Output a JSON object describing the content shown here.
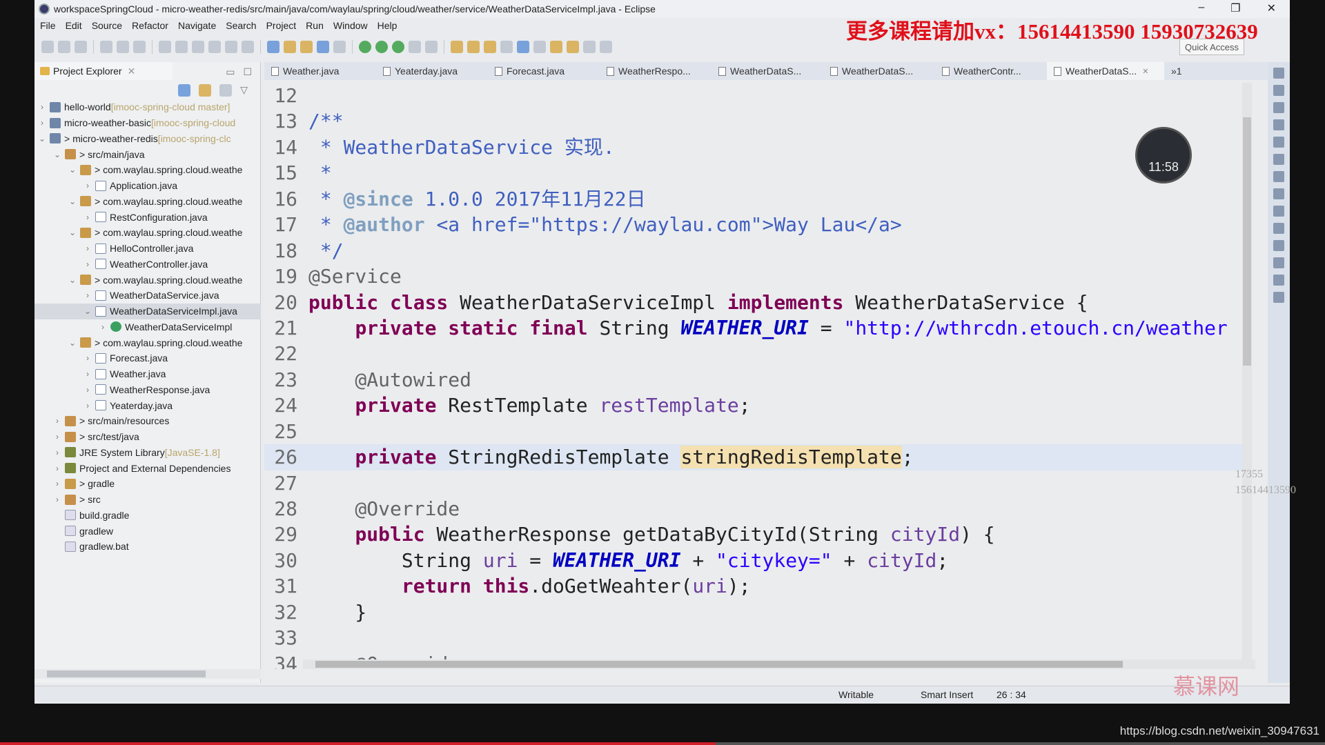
{
  "window": {
    "title": "workspaceSpringCloud - micro-weather-redis/src/main/java/com/waylau/spring/cloud/weather/service/WeatherDataServiceImpl.java - Eclipse",
    "controls": [
      "–",
      "❐",
      "✕"
    ]
  },
  "overlay": {
    "promo": "更多课程请加vx：15614413590  15930732639",
    "clock": "11:58",
    "side_watermark": [
      "17355",
      "15614413590"
    ],
    "url": "https://blog.csdn.net/weixin_30947631",
    "logo": "慕课网",
    "progress": 0.54
  },
  "menu": [
    "File",
    "Edit",
    "Source",
    "Refactor",
    "Navigate",
    "Search",
    "Project",
    "Run",
    "Window",
    "Help"
  ],
  "toolbar": {
    "quick_access": "Quick Access"
  },
  "explorer": {
    "title": "Project Explorer",
    "items": [
      {
        "d": 0,
        "tw": ">",
        "ic": "proj",
        "label": "hello-world",
        "dec": " [imooc-spring-cloud master]"
      },
      {
        "d": 0,
        "tw": ">",
        "ic": "proj",
        "label": "micro-weather-basic",
        "dec": " [imooc-spring-cloud"
      },
      {
        "d": 0,
        "tw": "v",
        "ic": "proj",
        "label": "> micro-weather-redis",
        "dec": " [imooc-spring-clc"
      },
      {
        "d": 1,
        "tw": "v",
        "ic": "src",
        "label": "> src/main/java"
      },
      {
        "d": 2,
        "tw": "v",
        "ic": "pkg",
        "label": "> com.waylau.spring.cloud.weathe"
      },
      {
        "d": 3,
        "tw": ">",
        "ic": "java",
        "label": "Application.java"
      },
      {
        "d": 2,
        "tw": "v",
        "ic": "pkg",
        "label": "> com.waylau.spring.cloud.weathe"
      },
      {
        "d": 3,
        "tw": ">",
        "ic": "java",
        "label": "RestConfiguration.java"
      },
      {
        "d": 2,
        "tw": "v",
        "ic": "pkg",
        "label": "> com.waylau.spring.cloud.weathe"
      },
      {
        "d": 3,
        "tw": ">",
        "ic": "java",
        "label": "HelloController.java"
      },
      {
        "d": 3,
        "tw": ">",
        "ic": "java",
        "label": "WeatherController.java"
      },
      {
        "d": 2,
        "tw": "v",
        "ic": "pkg",
        "label": "> com.waylau.spring.cloud.weathe"
      },
      {
        "d": 3,
        "tw": ">",
        "ic": "java",
        "label": "WeatherDataService.java"
      },
      {
        "d": 3,
        "tw": "v",
        "ic": "java",
        "label": "WeatherDataServiceImpl.java",
        "sel": true
      },
      {
        "d": 4,
        "tw": ">",
        "ic": "cls",
        "label": "WeatherDataServiceImpl"
      },
      {
        "d": 2,
        "tw": "v",
        "ic": "pkg",
        "label": "> com.waylau.spring.cloud.weathe"
      },
      {
        "d": 3,
        "tw": ">",
        "ic": "java",
        "label": "Forecast.java"
      },
      {
        "d": 3,
        "tw": ">",
        "ic": "java",
        "label": "Weather.java"
      },
      {
        "d": 3,
        "tw": ">",
        "ic": "java",
        "label": "WeatherResponse.java"
      },
      {
        "d": 3,
        "tw": ">",
        "ic": "java",
        "label": "Yeaterday.java"
      },
      {
        "d": 1,
        "tw": ">",
        "ic": "src",
        "label": "> src/main/resources"
      },
      {
        "d": 1,
        "tw": ">",
        "ic": "src",
        "label": "> src/test/java"
      },
      {
        "d": 1,
        "tw": ">",
        "ic": "lib",
        "label": "JRE System Library",
        "dec": " [JavaSE-1.8]"
      },
      {
        "d": 1,
        "tw": ">",
        "ic": "lib",
        "label": "Project and External Dependencies"
      },
      {
        "d": 1,
        "tw": ">",
        "ic": "pkg",
        "label": "> gradle"
      },
      {
        "d": 1,
        "tw": ">",
        "ic": "src",
        "label": "> src"
      },
      {
        "d": 1,
        "tw": "",
        "ic": "file",
        "label": "build.gradle"
      },
      {
        "d": 1,
        "tw": "",
        "ic": "file",
        "label": "gradlew"
      },
      {
        "d": 1,
        "tw": "",
        "ic": "file",
        "label": "gradlew.bat"
      }
    ]
  },
  "editor": {
    "tabs": [
      "Weather.java",
      "Yeaterday.java",
      "Forecast.java",
      "WeatherRespo...",
      "WeatherDataS...",
      "WeatherDataS...",
      "WeatherContr...",
      "WeatherDataS..."
    ],
    "active_tab": 7,
    "overflow": "»1",
    "lines": [
      {
        "n": "12",
        "t": []
      },
      {
        "n": "13",
        "t": [
          [
            "doc",
            "/**"
          ]
        ]
      },
      {
        "n": "14",
        "t": [
          [
            "doc",
            " * WeatherDataService 实现."
          ]
        ]
      },
      {
        "n": "15",
        "t": [
          [
            "doc",
            " *"
          ]
        ]
      },
      {
        "n": "16",
        "t": [
          [
            "doc",
            " * "
          ],
          [
            "tag",
            "@since"
          ],
          [
            "doc",
            " 1.0.0 2017年11月22日"
          ]
        ]
      },
      {
        "n": "17",
        "t": [
          [
            "doc",
            " * "
          ],
          [
            "tag",
            "@author"
          ],
          [
            "doc",
            " <a href=\"https://waylau.com\">Way Lau</a>"
          ]
        ]
      },
      {
        "n": "18",
        "t": [
          [
            "doc",
            " */"
          ]
        ]
      },
      {
        "n": "19",
        "t": [
          [
            "ann",
            "@Service"
          ]
        ]
      },
      {
        "n": "20",
        "t": [
          [
            "kw",
            "public class "
          ],
          [
            "pl",
            "WeatherDataServiceImpl "
          ],
          [
            "kw",
            "implements "
          ],
          [
            "pl",
            "WeatherDataService {"
          ]
        ]
      },
      {
        "n": "21",
        "t": [
          [
            "pl",
            "    "
          ],
          [
            "kw",
            "private static final "
          ],
          [
            "pl",
            "String "
          ],
          [
            "fld",
            "WEATHER_URI"
          ],
          [
            "pl",
            " = "
          ],
          [
            "str",
            "\"http://wthrcdn.etouch.cn/weather"
          ]
        ]
      },
      {
        "n": "22",
        "t": []
      },
      {
        "n": "23",
        "t": [
          [
            "ann",
            "    @Autowired"
          ]
        ]
      },
      {
        "n": "24",
        "t": [
          [
            "pl",
            "    "
          ],
          [
            "kw",
            "private "
          ],
          [
            "pl",
            "RestTemplate "
          ],
          [
            "fld2",
            "restTemplate"
          ],
          [
            "pl",
            ";"
          ]
        ]
      },
      {
        "n": "25",
        "t": []
      },
      {
        "n": "26",
        "t": [
          [
            "pl",
            "    "
          ],
          [
            "kw",
            "private "
          ],
          [
            "pl",
            "StringRedisTemplate "
          ],
          [
            "occ",
            "stringRedisTemplate"
          ],
          [
            "pl",
            ";"
          ]
        ],
        "hl": true
      },
      {
        "n": "27",
        "t": []
      },
      {
        "n": "28",
        "t": [
          [
            "ann",
            "    @Override"
          ]
        ]
      },
      {
        "n": "29",
        "t": [
          [
            "pl",
            "    "
          ],
          [
            "kw",
            "public "
          ],
          [
            "pl",
            "WeatherResponse getDataByCityId(String "
          ],
          [
            "var",
            "cityId"
          ],
          [
            "pl",
            ") {"
          ]
        ]
      },
      {
        "n": "30",
        "t": [
          [
            "pl",
            "        String "
          ],
          [
            "var",
            "uri"
          ],
          [
            "pl",
            " = "
          ],
          [
            "fld",
            "WEATHER_URI"
          ],
          [
            "pl",
            " + "
          ],
          [
            "str",
            "\"citykey=\""
          ],
          [
            "pl",
            " + "
          ],
          [
            "var",
            "cityId"
          ],
          [
            "pl",
            ";"
          ]
        ]
      },
      {
        "n": "31",
        "t": [
          [
            "pl",
            "        "
          ],
          [
            "kw",
            "return this"
          ],
          [
            "pl",
            ".doGetWeahter("
          ],
          [
            "var",
            "uri"
          ],
          [
            "pl",
            ");"
          ]
        ]
      },
      {
        "n": "32",
        "t": [
          [
            "pl",
            "    }"
          ]
        ]
      },
      {
        "n": "33",
        "t": []
      },
      {
        "n": "34",
        "t": [
          [
            "ann",
            "    @Override"
          ]
        ]
      }
    ]
  },
  "status": {
    "writable": "Writable",
    "insert_mode": "Smart Insert",
    "position": "26 : 34"
  }
}
